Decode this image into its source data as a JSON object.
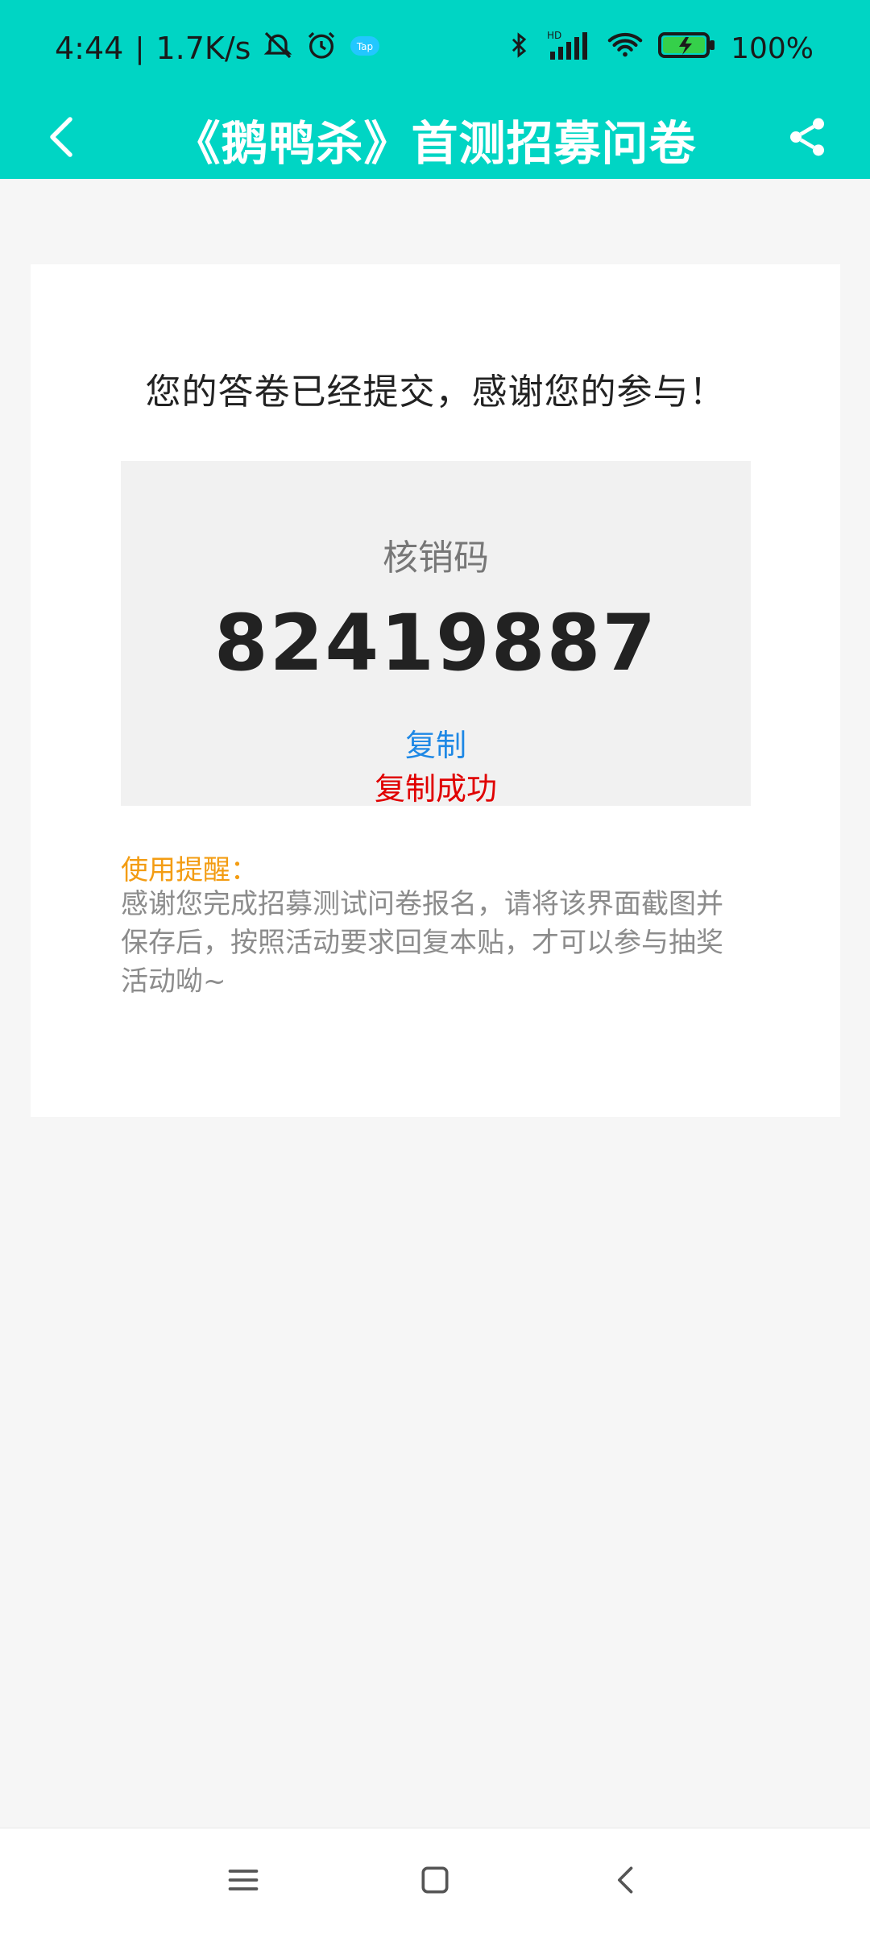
{
  "status_bar": {
    "time": "4:44",
    "speed": "1.7K/s",
    "battery": "100%"
  },
  "app_bar": {
    "title": "《鹅鸭杀》首测招募问卷"
  },
  "card": {
    "thanks_text": "您的答卷已经提交，感谢您的参与！",
    "code_label": "核销码",
    "code_value": "82419887",
    "copy_label": "复制",
    "copy_success": "复制成功",
    "tip_title": "使用提醒：",
    "tip_text": "感谢您完成招募测试问卷报名，请将该界面截图并保存后，按照活动要求回复本贴，才可以参与抽奖活动呦~"
  },
  "colors": {
    "header_bg": "#00d5c4",
    "link": "#1e88e5",
    "success": "#e00000",
    "tip": "#f39c12"
  },
  "icons": {
    "back": "back-arrow-icon",
    "share": "share-icon",
    "menu": "menu-icon",
    "home": "home-icon",
    "nav_back": "nav-back-icon"
  }
}
